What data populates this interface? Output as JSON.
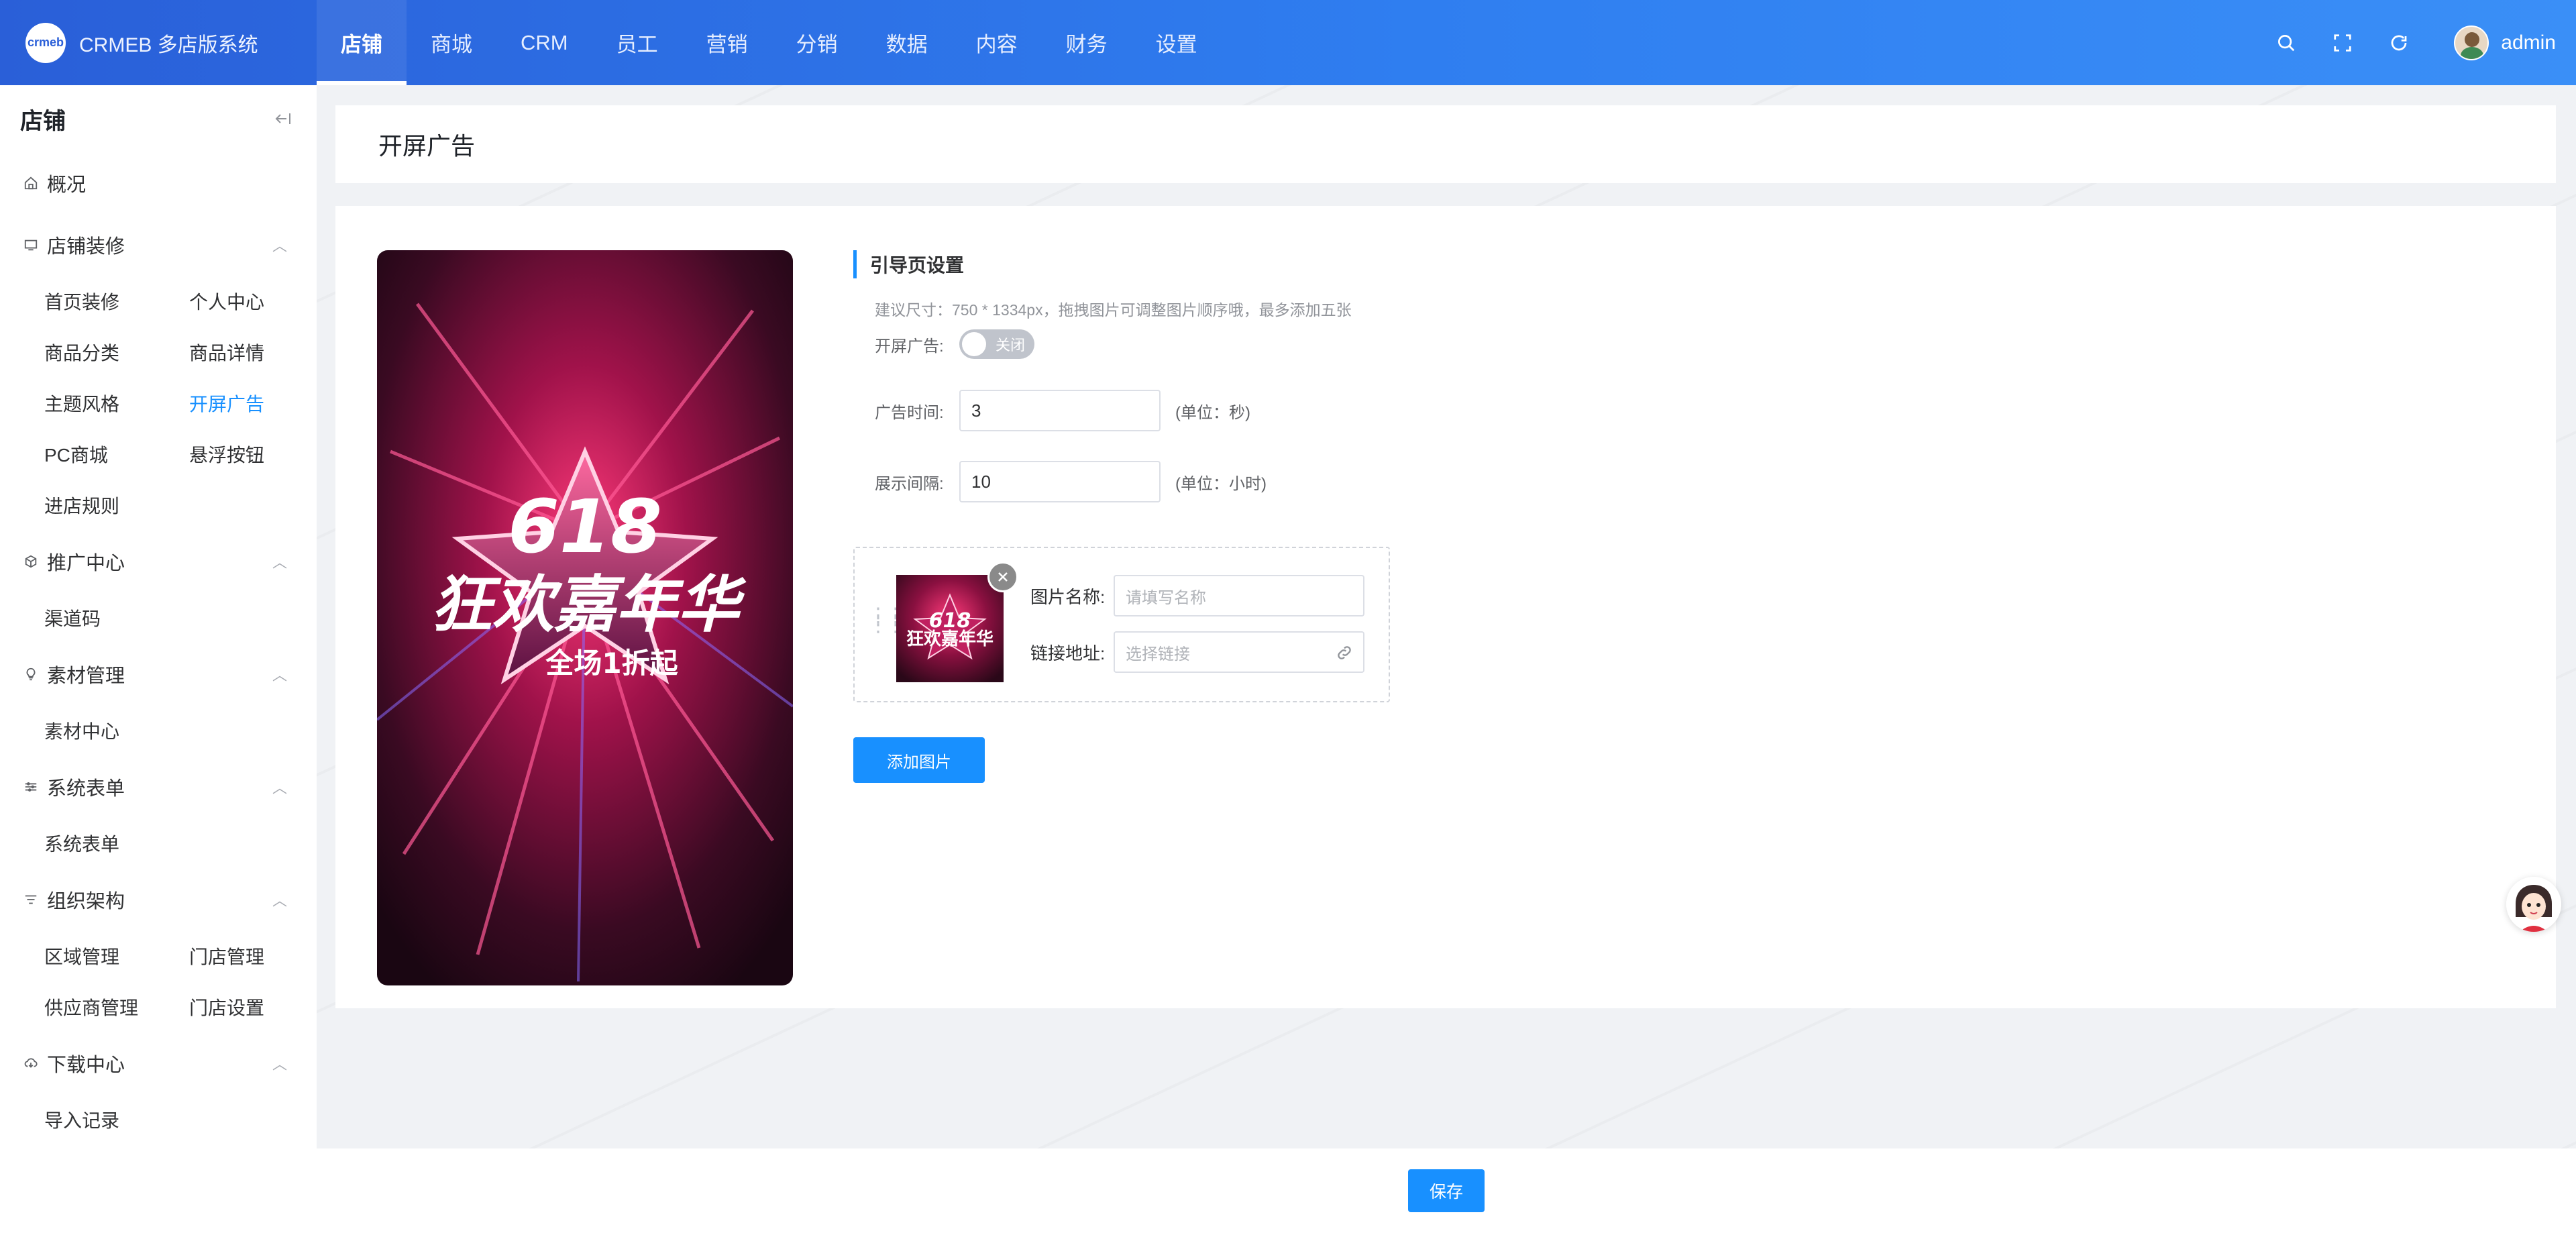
{
  "brand": {
    "logo_text": "crmeb",
    "name": "CRMEB 多店版系统"
  },
  "topnav": [
    "店铺",
    "商城",
    "CRM",
    "员工",
    "营销",
    "分销",
    "数据",
    "内容",
    "财务",
    "设置"
  ],
  "topnav_active": 0,
  "user": {
    "name": "admin"
  },
  "sidebar": {
    "title": "店铺",
    "overview": "概况",
    "groups": [
      {
        "title": "店铺装修",
        "icon": "monitor-icon",
        "items": [
          "首页装修",
          "个人中心",
          "商品分类",
          "商品详情",
          "主题风格",
          "开屏广告",
          "PC商城",
          "悬浮按钮",
          "进店规则"
        ]
      },
      {
        "title": "推广中心",
        "icon": "cube-icon",
        "items": [
          "渠道码"
        ]
      },
      {
        "title": "素材管理",
        "icon": "bulb-icon",
        "items": [
          "素材中心"
        ]
      },
      {
        "title": "系统表单",
        "icon": "sliders-icon",
        "items": [
          "系统表单"
        ]
      },
      {
        "title": "组织架构",
        "icon": "filter-icon",
        "items": [
          "区域管理",
          "门店管理",
          "供应商管理",
          "门店设置"
        ]
      },
      {
        "title": "下载中心",
        "icon": "cloud-download-icon",
        "items": [
          "导入记录"
        ]
      }
    ],
    "active_item": "开屏广告"
  },
  "page": {
    "title": "开屏广告"
  },
  "poster": {
    "number": "618",
    "line1": "狂欢嘉年华",
    "line2": "全场1折起"
  },
  "settings": {
    "section_title": "引导页设置",
    "hint": "建议尺寸：750 * 1334px，拖拽图片可调整图片顺序哦，最多添加五张",
    "splash_label": "开屏广告:",
    "splash_switch_text": "关闭",
    "ad_time_label": "广告时间:",
    "ad_time_value": "3",
    "ad_time_unit": "(单位：秒)",
    "interval_label": "展示间隔:",
    "interval_value": "10",
    "interval_unit": "(单位：小时)"
  },
  "image_item": {
    "name_label": "图片名称:",
    "name_placeholder": "请填写名称",
    "link_label": "链接地址:",
    "link_placeholder": "选择链接"
  },
  "add_image_button": "添加图片",
  "save_button": "保存",
  "colors": {
    "primary": "#1890ff",
    "topbar_start": "#2a5fd8",
    "topbar_end": "#3a8ff7"
  }
}
